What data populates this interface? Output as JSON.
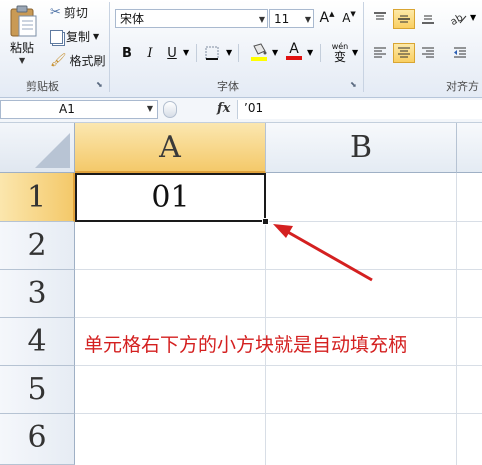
{
  "ribbon": {
    "clipboard": {
      "paste_label": "粘贴",
      "cut_label": "剪切",
      "copy_label": "复制",
      "format_painter_label": "格式刷",
      "group_label": "剪贴板"
    },
    "font": {
      "font_name": "宋体",
      "font_size": "11",
      "grow_font": "A",
      "shrink_font": "A",
      "bold": "B",
      "italic": "I",
      "underline": "U",
      "font_color_glyph": "A",
      "phonetic_glyph": "wén",
      "phonetic_char": "变",
      "group_label": "字体"
    },
    "alignment": {
      "group_label": "对齐方"
    }
  },
  "formula_bar": {
    "name_box": "A1",
    "fx_label": "fx",
    "formula": "’01"
  },
  "grid": {
    "columns": [
      "A",
      "B"
    ],
    "rows": [
      "1",
      "2",
      "3",
      "4",
      "5",
      "6"
    ],
    "cell_a1": "01"
  },
  "annotation": {
    "text": "单元格右下方的小方块就是自动填充柄",
    "color": "#d42020"
  },
  "colors": {
    "selected_header": "#f6d07a",
    "ribbon_bg": "#eef2f8",
    "annotation_red": "#d42020"
  }
}
